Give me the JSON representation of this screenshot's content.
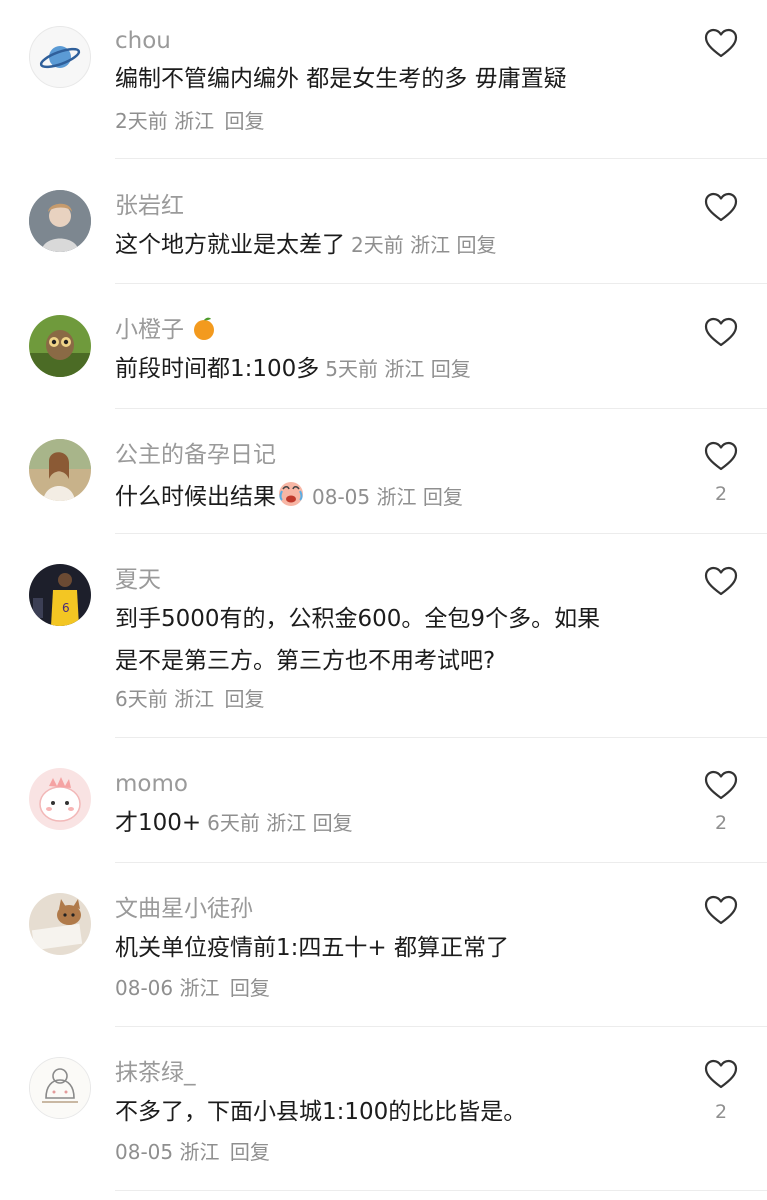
{
  "comments": [
    {
      "username": "chou",
      "text_lines": [
        "编制不管编内编外 都是女生考的多 毋庸置疑"
      ],
      "time": "2天前",
      "location": "浙江",
      "reply_label": "回复",
      "like_count": "",
      "avatar_icon": "planet-icon"
    },
    {
      "username": "张岩红",
      "text_lines": [
        "这个地方就业是太差了"
      ],
      "time": "2天前",
      "location": "浙江",
      "reply_label": "回复",
      "like_count": "",
      "avatar_icon": "person-photo"
    },
    {
      "username": "小橙子",
      "username_emoji": "orange-emoji",
      "text_lines": [
        "前段时间都1:100多"
      ],
      "time": "5天前",
      "location": "浙江",
      "reply_label": "回复",
      "like_count": "",
      "avatar_icon": "owl-photo"
    },
    {
      "username": "公主的备孕日记",
      "text_lines": [
        "什么时候出结果"
      ],
      "text_emoji": "crying-emoji",
      "time": "08-05",
      "location": "浙江",
      "reply_label": "回复",
      "like_count": "2",
      "avatar_icon": "woman-photo"
    },
    {
      "username": "夏天",
      "text_lines": [
        "到手5000有的，公积金600。全包9个多。如果",
        "是不是第三方。第三方也不用考试吧?"
      ],
      "time": "6天前",
      "location": "浙江",
      "reply_label": "回复",
      "like_count": "",
      "avatar_icon": "basketball-player-photo"
    },
    {
      "username": "momo",
      "text_lines": [
        "才100+"
      ],
      "time": "6天前",
      "location": "浙江",
      "reply_label": "回复",
      "like_count": "2",
      "avatar_icon": "pink-dinosaur-avatar"
    },
    {
      "username": "文曲星小徒孙",
      "text_lines": [
        "机关单位疫情前1:四五十+ 都算正常了"
      ],
      "time": "08-06",
      "location": "浙江",
      "reply_label": "回复",
      "like_count": "",
      "avatar_icon": "cat-photo"
    },
    {
      "username": "抹茶绿_",
      "text_lines": [
        "不多了，下面小县城1:100的比比皆是。"
      ],
      "time": "08-05",
      "location": "浙江",
      "reply_label": "回复",
      "like_count": "2",
      "avatar_icon": "cartoon-sketch-avatar"
    }
  ],
  "icons": {
    "like": "heart-outline-icon"
  },
  "colors": {
    "username": "#9a9a9a",
    "body": "#1c1c1c",
    "meta": "#8f8f8f",
    "divider": "#ececec"
  }
}
